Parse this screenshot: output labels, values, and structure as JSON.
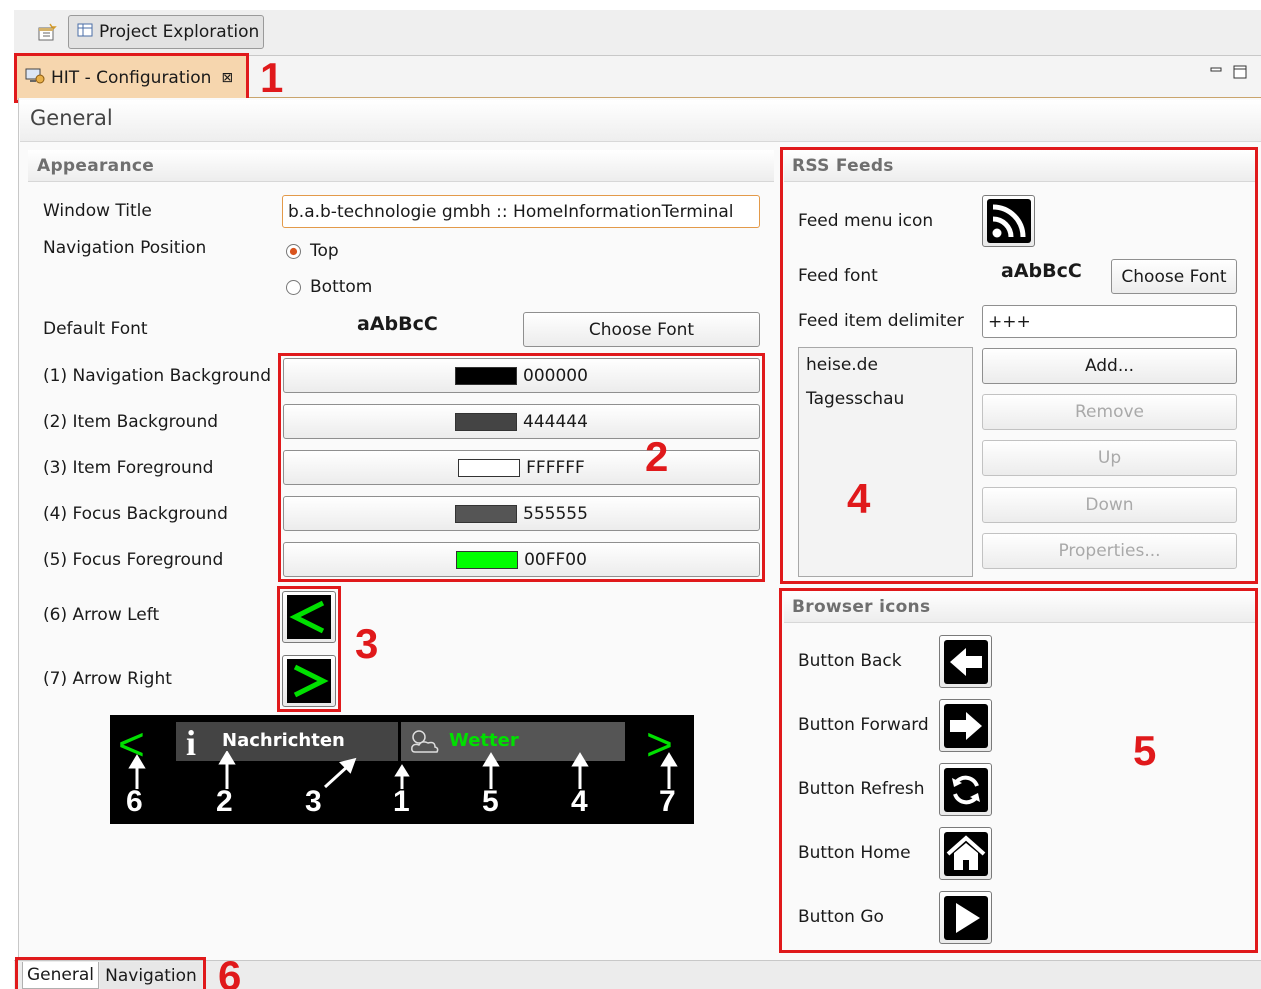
{
  "top_tabs": {
    "perspective_icon": "open-perspective-icon",
    "project_tab_label": "Project Exploration",
    "project_tab_icon": "table-icon"
  },
  "editor_tab": {
    "label": "HIT - Configuration",
    "icon": "monitor-config-icon",
    "close_icon": "close-icon"
  },
  "window_controls": {
    "minimize_icon": "minimize-icon",
    "maximize_icon": "maximize-icon"
  },
  "page": {
    "title": "General"
  },
  "appearance": {
    "heading": "Appearance",
    "window_title_label": "Window Title",
    "window_title_value": "b.a.b-technologie gmbh :: HomeInformationTerminal",
    "nav_position_label": "Navigation Position",
    "nav_options": [
      "Top",
      "Bottom"
    ],
    "nav_selected": "Top",
    "default_font_label": "Default Font",
    "font_sample": "aAbBcC",
    "choose_font": "Choose Font",
    "colors": [
      {
        "label": "(1) Navigation Background",
        "value": "000000",
        "color": "#000000"
      },
      {
        "label": "(2) Item Background",
        "value": "444444",
        "color": "#444444"
      },
      {
        "label": "(3) Item Foreground",
        "value": "FFFFFF",
        "color": "#FFFFFF"
      },
      {
        "label": "(4) Focus Background",
        "value": "555555",
        "color": "#555555"
      },
      {
        "label": "(5) Focus Foreground",
        "value": "00FF00",
        "color": "#00FF00"
      }
    ],
    "arrow_left_label": "(6) Arrow Left",
    "arrow_right_label": "(7) Arrow Right"
  },
  "preview": {
    "left_arrow": "<",
    "right_arrow": ">",
    "item1_label": "Nachrichten",
    "item1_icon": "info-icon",
    "item2_label": "Wetter",
    "item2_icon": "weather-cloud-sun-icon",
    "numbers": [
      "6",
      "2",
      "3",
      "1",
      "5",
      "4",
      "7"
    ]
  },
  "rss": {
    "heading": "RSS Feeds",
    "feed_menu_icon_label": "Feed menu icon",
    "feed_icon": "rss-icon",
    "feed_font_label": "Feed font",
    "font_sample": "aAbBcC",
    "choose_font": "Choose Font",
    "delimiter_label": "Feed item delimiter",
    "delimiter_value": "+++",
    "feeds": [
      "heise.de",
      "Tagesschau"
    ],
    "buttons": {
      "add": "Add...",
      "remove": "Remove",
      "up": "Up",
      "down": "Down",
      "properties": "Properties..."
    }
  },
  "browser_icons": {
    "heading": "Browser icons",
    "items": [
      {
        "label": "Button Back",
        "icon": "arrow-left-icon"
      },
      {
        "label": "Button Forward",
        "icon": "arrow-right-icon"
      },
      {
        "label": "Button Refresh",
        "icon": "refresh-icon"
      },
      {
        "label": "Button Home",
        "icon": "home-icon"
      },
      {
        "label": "Button Go",
        "icon": "play-icon"
      }
    ]
  },
  "bottom_tabs": [
    "General",
    "Navigation"
  ],
  "annotations": [
    "1",
    "2",
    "3",
    "4",
    "5",
    "6"
  ],
  "colors": {
    "annotation_red": "#e0191b",
    "focus_green": "#00FF00",
    "active_tab": "#f6d6ae"
  }
}
